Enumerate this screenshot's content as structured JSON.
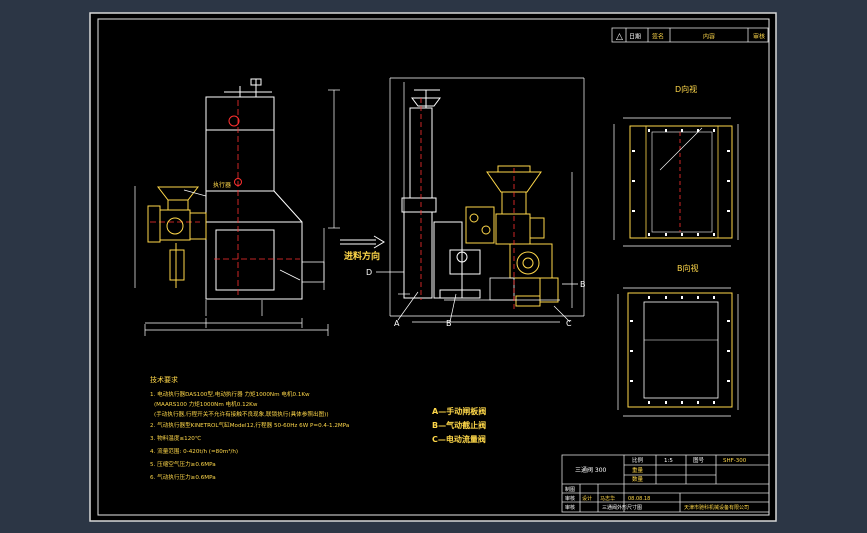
{
  "revision_table": {
    "symbol": "△",
    "col_date": "日期",
    "col_signature": "签名",
    "col_content": "内容",
    "col_approve": "审核"
  },
  "view_labels": {
    "d_view": "D向视",
    "b_view": "B向视",
    "feed_direction": "进料方向",
    "marker_a": "A",
    "marker_b": "B",
    "marker_c": "C",
    "marker_d": "D",
    "marker_b_arrow": "B"
  },
  "tech_notes": {
    "title": "技术要求",
    "items": [
      "1. 电动执行器DAS100型,电动执行器 力矩1000Nm 电机0.1Kw",
      "(MAARS100 力矩1000Nm 电机0.12Kw",
      "(手动执行器,行程开关不允许有接触不良现象,联锁执行(具体参照出图))",
      "2. 气动执行器型KINETROL气缸Model12,行程器 50-60Hz 6W P=0.4-1.2MPa",
      "3. 物料温度≤120℃",
      "4. 流量范围: 0-420t/h (=80m³/h)",
      "5. 压缩空气压力≥0.6MPa",
      "6. 气动执行压力≥0.6MPa"
    ]
  },
  "legend": [
    "A—手动闸板阀",
    "B—气动截止阀",
    "C—电动流量阀"
  ],
  "title_block": {
    "name": "三通阀 300",
    "ratio_label": "比例",
    "ratio_value": "1:5",
    "drawing_no_label": "图号",
    "drawing_no_value": "SHF-300",
    "weight_label": "重量",
    "qty_label": "数量",
    "draw_label": "制图",
    "check_label": "审核",
    "design_label": "设计",
    "approve_label": "审核",
    "designer": "马志华",
    "date": "08.08.18",
    "description": "三通阀外形尺寸图",
    "company": "天津市驰科机械设备有限公司"
  }
}
